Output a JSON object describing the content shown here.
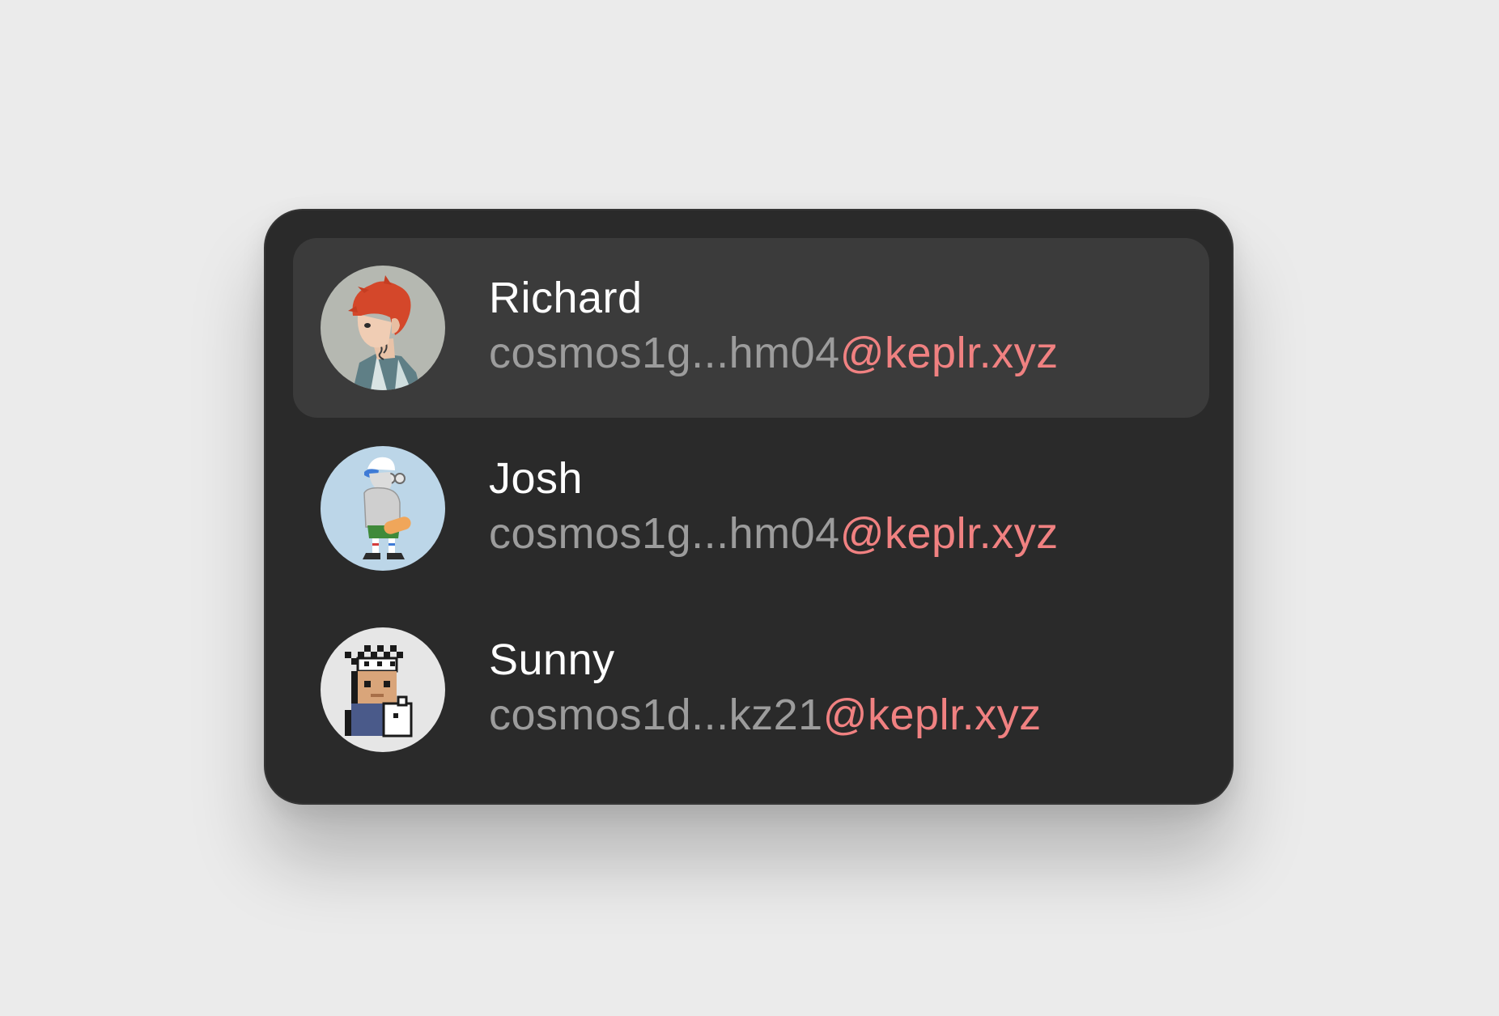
{
  "colors": {
    "background": "#ebebeb",
    "card": "#2a2a2a",
    "selected_row": "#3b3b3b",
    "name_text": "#ffffff",
    "address_text": "#9c9c9c",
    "domain_text": "#f08181"
  },
  "accounts": [
    {
      "name": "Richard",
      "address": "cosmos1g...hm04",
      "domain": "@keplr.xyz",
      "avatar": "anime-character-avatar-icon",
      "selected": true
    },
    {
      "name": "Josh",
      "address": "cosmos1g...hm04",
      "domain": "@keplr.xyz",
      "avatar": "skater-character-avatar-icon",
      "selected": false
    },
    {
      "name": "Sunny",
      "address": "cosmos1d...kz21",
      "domain": "@keplr.xyz",
      "avatar": "pixel-art-avatar-icon",
      "selected": false
    }
  ]
}
